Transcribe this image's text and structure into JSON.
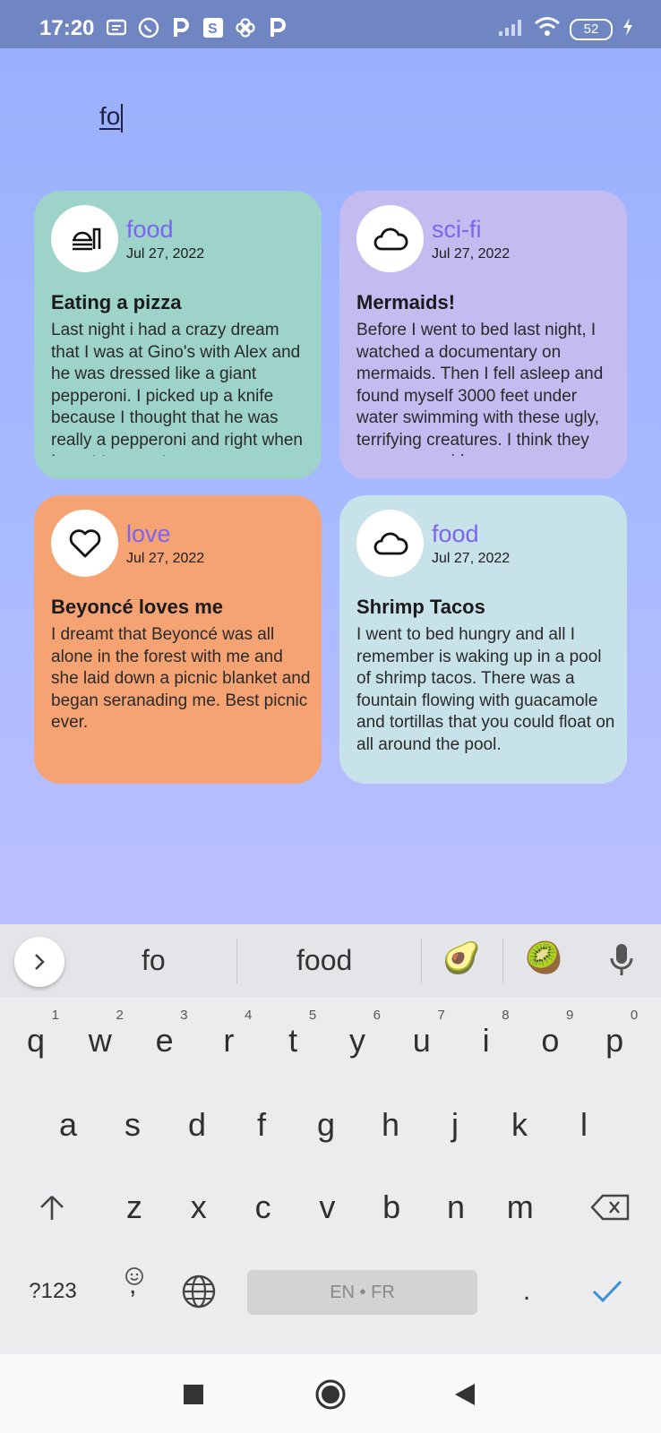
{
  "status_bar": {
    "time": "17:20",
    "notification_icons": [
      "message-icon",
      "whatsapp-icon",
      "p-app-icon",
      "s-app-icon",
      "pinwheel-icon",
      "p-app-icon"
    ],
    "battery": "52"
  },
  "search": {
    "value": "fo"
  },
  "cards": [
    {
      "icon": "food-icon",
      "category": "food",
      "date": "Jul 27, 2022",
      "title": "Eating a pizza",
      "body": "Last night i had a crazy dream that I was at Gino's with Alex and he was dressed like a giant pepperoni. I picked up a knife because I thought that he was really a pepperoni and right when I went to go cut a",
      "color": "#9dd3c9"
    },
    {
      "icon": "cloud-icon",
      "category": "sci-fi",
      "date": "Jul 27, 2022",
      "title": "Mermaids!",
      "body": "Before I went to bed last night, I watched a documentary on mermaids. Then I fell asleep and found myself 3000 feet under water swimming with these ugly, terrifying creatures. I think they were mermaids",
      "color": "#c4bcf1"
    },
    {
      "icon": "heart-icon",
      "category": "love",
      "date": "Jul 27, 2022",
      "title": "Beyoncé loves me",
      "body": "I dreamt that Beyoncé was all alone in the forest with me and she laid down a picnic blanket and began seranading me. Best picnic ever.",
      "color": "#f6a373"
    },
    {
      "icon": "cloud-icon",
      "category": "food",
      "date": "Jul 27, 2022",
      "title": "Shrimp Tacos",
      "body": "I went to bed hungry and all I remember is waking up in a pool of shrimp tacos. There was a fountain flowing with guacamole and tortillas that you could float on all around the pool.",
      "color": "#c7e2e9"
    }
  ],
  "keyboard": {
    "suggestions": [
      "fo",
      "food"
    ],
    "emojis": [
      "🥑",
      "🥝"
    ],
    "row1": [
      {
        "k": "q",
        "h": "1"
      },
      {
        "k": "w",
        "h": "2"
      },
      {
        "k": "e",
        "h": "3"
      },
      {
        "k": "r",
        "h": "4"
      },
      {
        "k": "t",
        "h": "5"
      },
      {
        "k": "y",
        "h": "6"
      },
      {
        "k": "u",
        "h": "7"
      },
      {
        "k": "i",
        "h": "8"
      },
      {
        "k": "o",
        "h": "9"
      },
      {
        "k": "p",
        "h": "0"
      }
    ],
    "row2": [
      "a",
      "s",
      "d",
      "f",
      "g",
      "h",
      "j",
      "k",
      "l"
    ],
    "row3": [
      "z",
      "x",
      "c",
      "v",
      "b",
      "n",
      "m"
    ],
    "symbols_label": "?123",
    "comma": ",",
    "space_label": "EN • FR",
    "period": "."
  }
}
